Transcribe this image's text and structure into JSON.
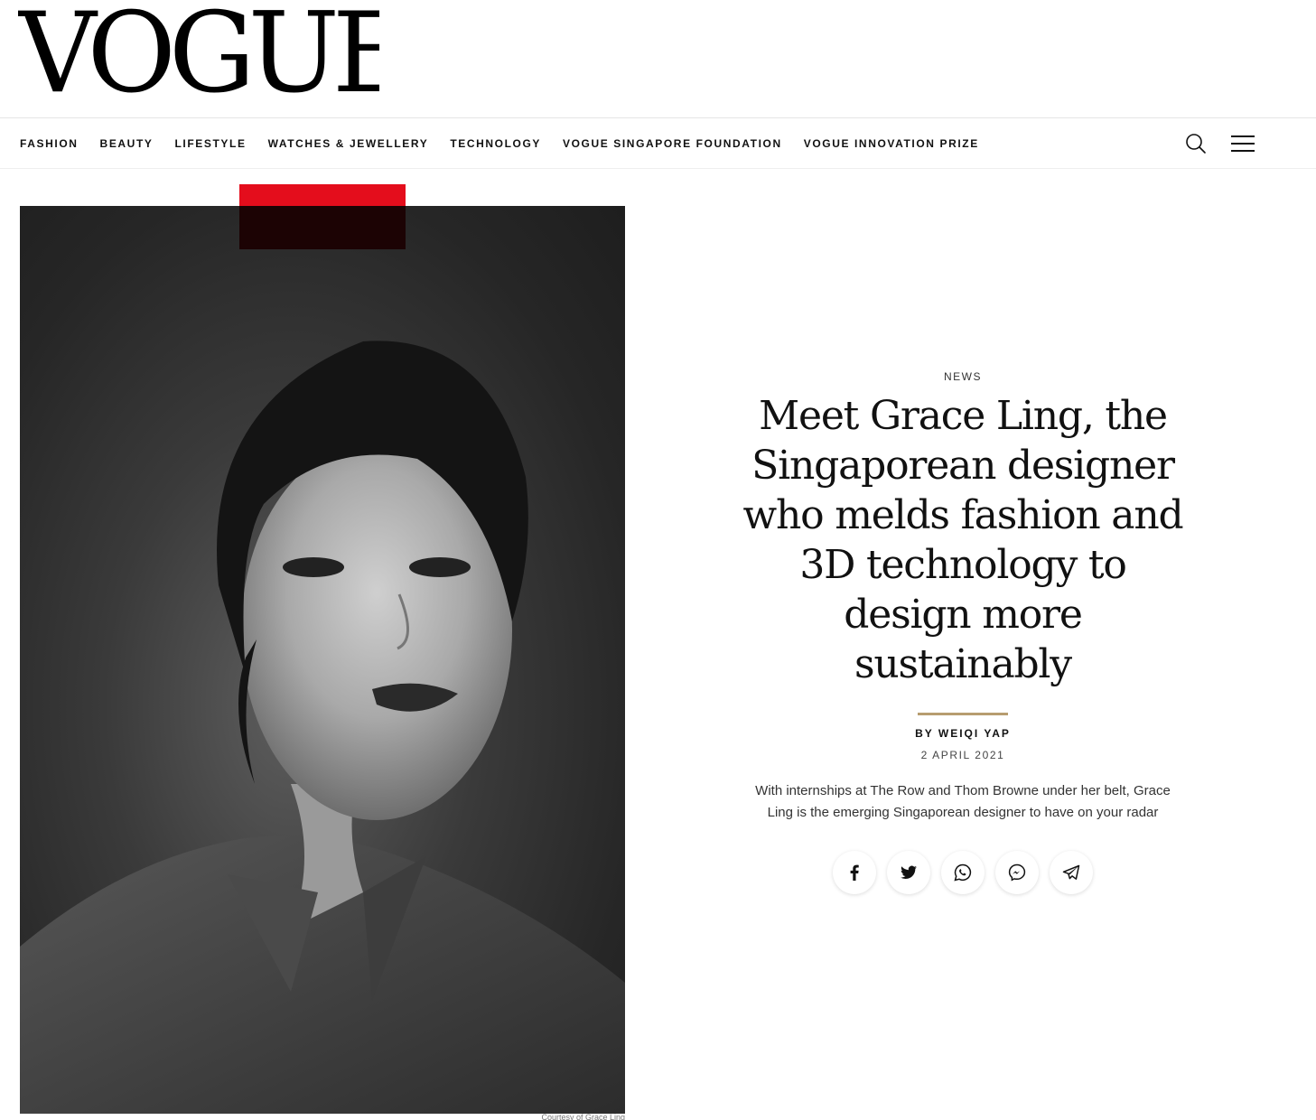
{
  "header": {
    "logo_text": "VOGUE"
  },
  "nav": {
    "links": [
      "FASHION",
      "BEAUTY",
      "LIFESTYLE",
      "WATCHES & JEWELLERY",
      "TECHNOLOGY",
      "VOGUE SINGAPORE FOUNDATION",
      "VOGUE INNOVATION PRIZE"
    ],
    "icons": [
      "search-icon",
      "hamburger-menu-icon"
    ]
  },
  "hero": {
    "image": "black-and-white portrait photo",
    "credit": "Courtesy of Grace Ling",
    "accent_color": "#e40d1c"
  },
  "article": {
    "category": "NEWS",
    "headline": "Meet Grace Ling, the Singaporean designer who melds fashion and 3D technology to design more sustainably",
    "byline": "BY WEIQI YAP",
    "date": "2 APRIL 2021",
    "dek": "With internships at The Row and Thom Browne under her belt, Grace Ling is the emerging Singaporean designer to have on your radar",
    "rule_color": "#b79d70"
  },
  "share": {
    "icons": [
      "facebook-icon",
      "twitter-icon",
      "whatsapp-icon",
      "messenger-icon",
      "telegram-icon"
    ]
  }
}
